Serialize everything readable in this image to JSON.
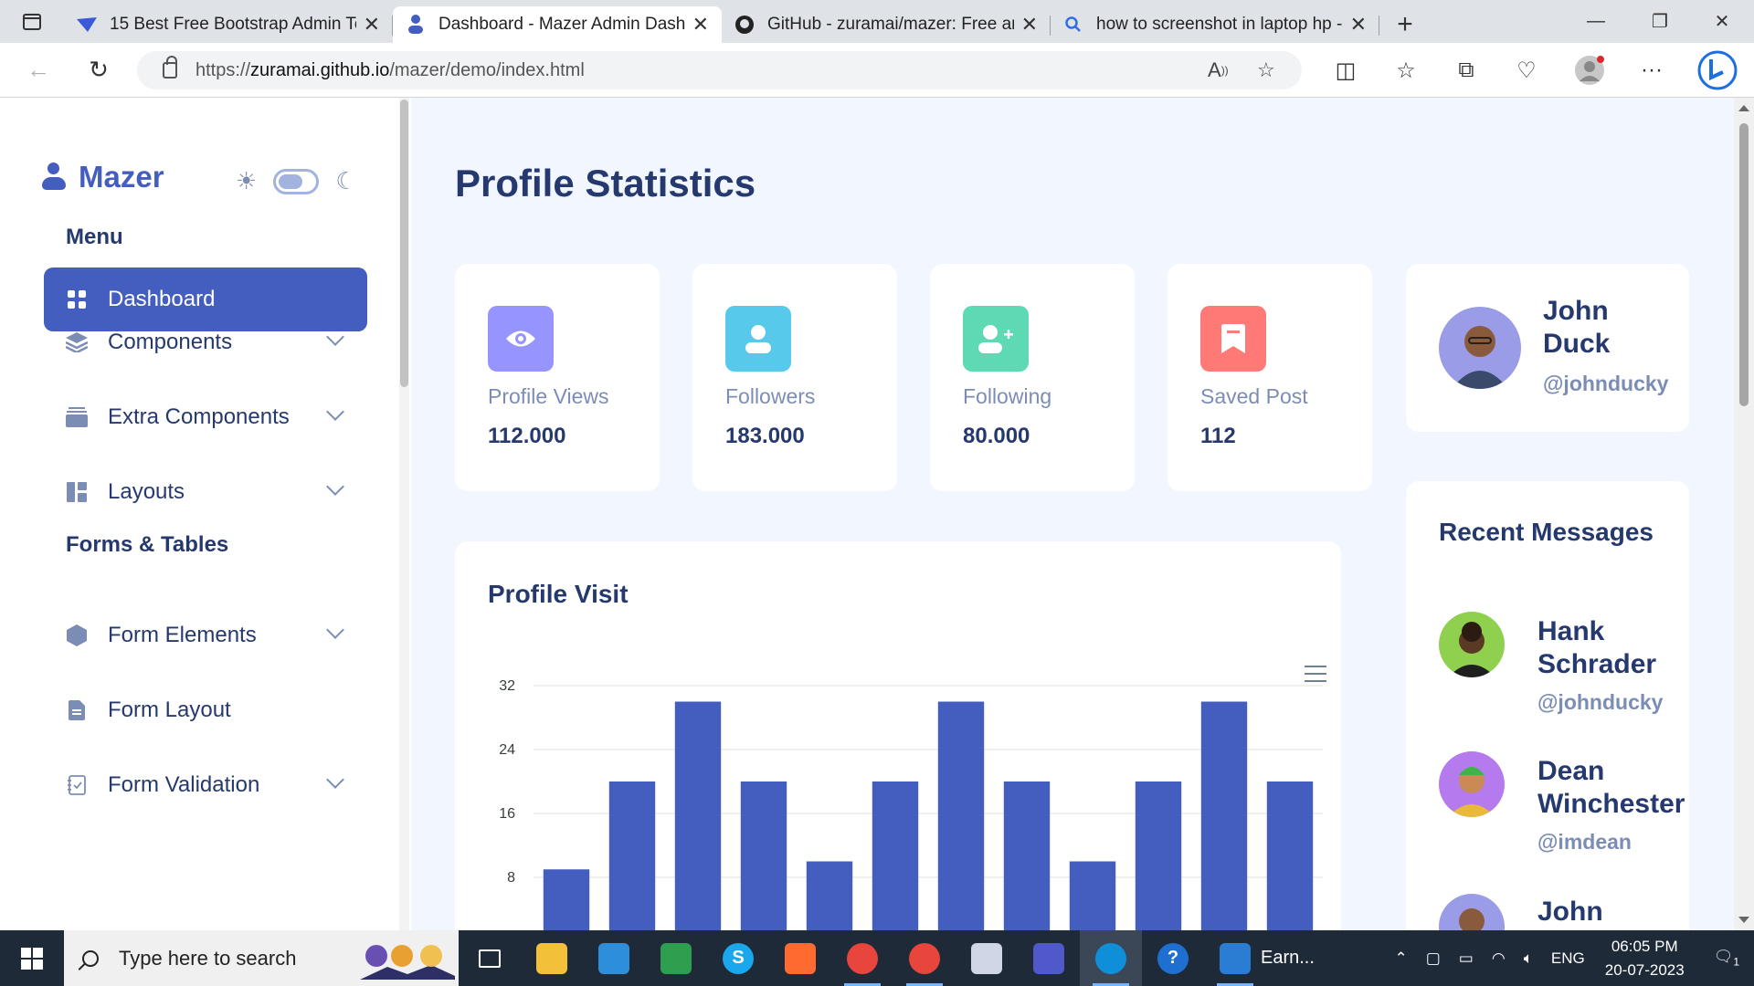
{
  "browser": {
    "tabs": [
      {
        "title": "15 Best Free Bootstrap Admin Te",
        "favicon": "colorlib-icon",
        "active": false
      },
      {
        "title": "Dashboard - Mazer Admin Dashb",
        "favicon": "mazer-icon",
        "active": true
      },
      {
        "title": "GitHub - zuramai/mazer: Free an",
        "favicon": "github-icon",
        "active": false
      },
      {
        "title": "how to screenshot in laptop hp -",
        "favicon": "search-icon",
        "active": false
      }
    ],
    "address": {
      "prefix": "https://",
      "host": "zuramai.github.io",
      "path": "/mazer/demo/index.html"
    }
  },
  "sidebar": {
    "brand": "Mazer",
    "sections": [
      {
        "title": "Menu"
      },
      {
        "title": "Forms & Tables"
      }
    ],
    "items": [
      {
        "label": "Dashboard",
        "icon": "grid-icon",
        "active": true,
        "has_children": false
      },
      {
        "label": "Components",
        "icon": "stack-icon",
        "active": false,
        "has_children": true
      },
      {
        "label": "Extra Components",
        "icon": "collection-icon",
        "active": false,
        "has_children": true
      },
      {
        "label": "Layouts",
        "icon": "layout-icon",
        "active": false,
        "has_children": true
      },
      {
        "label": "Form Elements",
        "icon": "hexagon-icon",
        "active": false,
        "has_children": true
      },
      {
        "label": "Form Layout",
        "icon": "file-text-icon",
        "active": false,
        "has_children": false
      },
      {
        "label": "Form Validation",
        "icon": "journal-check-icon",
        "active": false,
        "has_children": true
      }
    ]
  },
  "main": {
    "title": "Profile Statistics",
    "stats": [
      {
        "label": "Profile Views",
        "value": "112.000",
        "icon": "eye-icon",
        "color": "#9694ff"
      },
      {
        "label": "Followers",
        "value": "183.000",
        "icon": "person-icon",
        "color": "#57caeb"
      },
      {
        "label": "Following",
        "value": "80.000",
        "icon": "person-add-icon",
        "color": "#5ddab4"
      },
      {
        "label": "Saved Post",
        "value": "112",
        "icon": "bookmark-icon",
        "color": "#ff7976"
      }
    ],
    "chart_title": "Profile Visit"
  },
  "chart_data": {
    "type": "bar",
    "title": "Profile Visit",
    "series": [
      {
        "values": [
          9,
          20,
          30,
          20,
          10,
          20,
          30,
          20,
          10,
          20,
          30,
          20
        ]
      }
    ],
    "yticks": [
      8,
      16,
      24,
      32
    ],
    "ylim": [
      0,
      32
    ],
    "grid": true,
    "color": "#435ebe"
  },
  "profile": {
    "name": "John Duck",
    "handle": "@johnducky"
  },
  "messages": {
    "title": "Recent Messages",
    "items": [
      {
        "name": "Hank Schrader",
        "handle": "@johnducky",
        "avatar_color": "#8fd14f"
      },
      {
        "name": "Dean Winchester",
        "handle": "@imdean",
        "avatar_color": "#b57bee"
      },
      {
        "name": "John",
        "handle": "",
        "avatar_color": "#9a9ce8"
      }
    ]
  },
  "taskbar": {
    "search_placeholder": "Type here to search",
    "apps": [
      {
        "name": "task-view-icon",
        "color": "#1f2a38",
        "label": ""
      },
      {
        "name": "file-explorer-icon",
        "color": "#f3c03a",
        "label": ""
      },
      {
        "name": "vscode-icon",
        "color": "#2d8fdb",
        "label": ""
      },
      {
        "name": "rocket-app-icon",
        "color": "#2e9e4f",
        "label": ""
      },
      {
        "name": "skype-icon",
        "color": "#1aa7ec",
        "label": "S"
      },
      {
        "name": "pen-app-icon",
        "color": "#ff6a30",
        "label": ""
      },
      {
        "name": "chrome-profile-k-icon",
        "color": "#e8453c",
        "label": ""
      },
      {
        "name": "chrome-icon",
        "color": "#e8453c",
        "label": ""
      },
      {
        "name": "notes-app-icon",
        "color": "#cfd6e6",
        "label": ""
      },
      {
        "name": "teams-icon",
        "color": "#5059c9",
        "label": ""
      },
      {
        "name": "edge-icon",
        "color": "#0f8fd8",
        "label": ""
      },
      {
        "name": "help-icon",
        "color": "#1f6fd1",
        "label": "?"
      },
      {
        "name": "earn-doc-icon",
        "color": "#2b7cd3",
        "label": ""
      }
    ],
    "running_label": "Earn...",
    "tray": {
      "lang": "ENG",
      "time": "06:05 PM",
      "date": "20-07-2023",
      "notifications": "1"
    }
  }
}
